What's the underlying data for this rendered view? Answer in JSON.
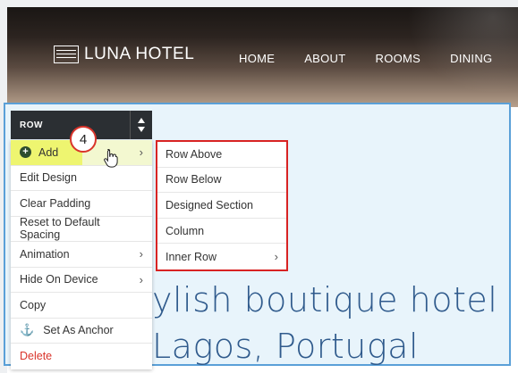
{
  "site": {
    "logo_text": "LUNA HOTEL",
    "nav": [
      "HOME",
      "ABOUT",
      "ROOMS",
      "DINING"
    ],
    "hero_lines": [
      "ylish boutique hotel",
      "Lagos, Portugal"
    ]
  },
  "editor": {
    "row_label": "ROW",
    "step_number": "4",
    "menu": {
      "add": "Add",
      "edit_design": "Edit Design",
      "clear_padding": "Clear Padding",
      "reset_spacing": "Reset to Default Spacing",
      "animation": "Animation",
      "hide_on_device": "Hide On Device",
      "copy": "Copy",
      "set_as_anchor": "Set As Anchor",
      "delete": "Delete"
    },
    "submenu": {
      "row_above": "Row Above",
      "row_below": "Row Below",
      "designed_section": "Designed Section",
      "column": "Column",
      "inner_row": "Inner Row"
    }
  },
  "colors": {
    "highlight": "#eef570",
    "callout_red": "#d82323",
    "hero_text": "#2f5a8c",
    "edit_area_border": "#5aa0d8"
  },
  "icons": {
    "add": "plus-circle-icon",
    "anchor": "anchor-icon",
    "submenu_arrow": "chevron-right-icon",
    "row_up": "arrow-up-icon",
    "row_down": "arrow-down-icon",
    "pointer": "hand-pointer-icon"
  }
}
